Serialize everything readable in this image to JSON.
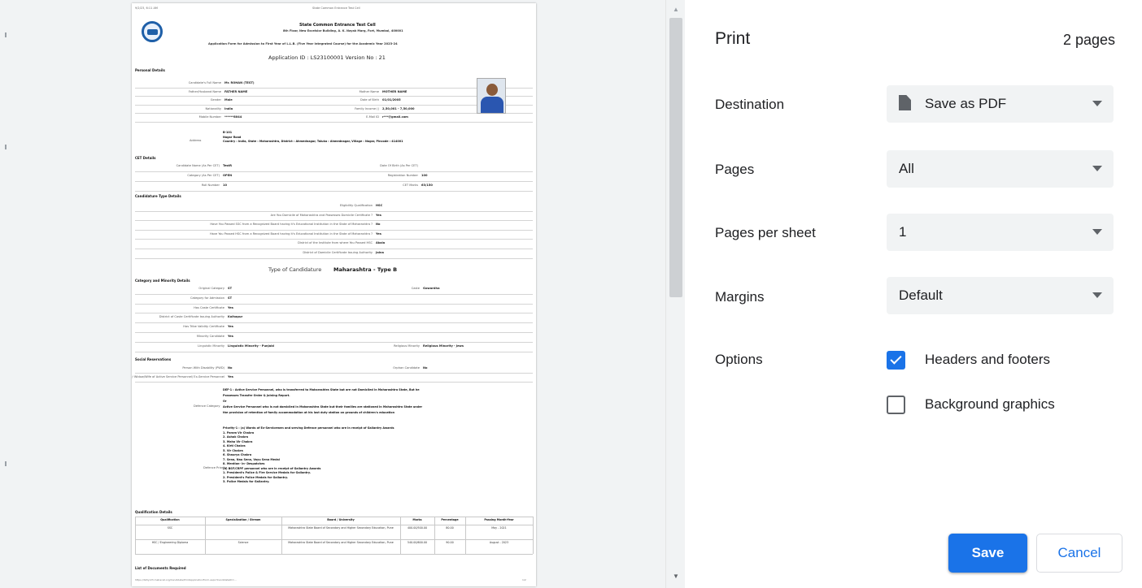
{
  "window": {
    "title": "Print"
  },
  "colors": {
    "accent": "#1a73e8",
    "panel_bg": "#ffffff",
    "preview_bg": "#f1f3f4"
  },
  "settings": {
    "title": "Print",
    "page_count": "2 pages",
    "destination": {
      "label": "Destination",
      "value": "Save as PDF",
      "icon": "pdf-file-icon"
    },
    "pages": {
      "label": "Pages",
      "value": "All"
    },
    "pages_per_sheet": {
      "label": "Pages per sheet",
      "value": "1"
    },
    "margins": {
      "label": "Margins",
      "value": "Default"
    },
    "options": {
      "label": "Options",
      "headers_footers": {
        "label": "Headers and footers",
        "checked": true
      },
      "background_graphics": {
        "label": "Background graphics",
        "checked": false
      }
    },
    "save_label": "Save",
    "cancel_label": "Cancel"
  },
  "preview": {
    "header_left": "9/2/23, 6:11 AM",
    "header_center": "State Common Entrance Test Cell",
    "org_name": "State Common Entrance Test Cell",
    "org_address": "8th Floor, New Excelsior Building, A. K. Nayak Marg, Fort, Mumbai, 400001",
    "form_title": "Application Form for Admission to First Year of L.L.B. (Five Year Integrated Course) for the Academic Year 2023-24",
    "application_line": "Application ID : LS23100001   Version No : 21",
    "sections": {
      "personal": "Personal Details",
      "cet": "CET Details",
      "candidature": "Candidature Type Details",
      "category": "Category and Minority Details",
      "social": "Social Reservations",
      "qualification": "Qualification Details",
      "documents": "List of Documents Required"
    },
    "personal": [
      {
        "label": "Candidate's Full Name",
        "value": "Mr. ROHAN (TEST)"
      },
      {
        "label": "Father/Husband Name",
        "value": "FATHER NAME",
        "label2": "Mother Name",
        "value2": "MOTHER NAME"
      },
      {
        "label": "Gender",
        "value": "Male",
        "label2": "Date of Birth",
        "value2": "01/01/2005"
      },
      {
        "label": "Nationality",
        "value": "India",
        "label2": "Family Income ()",
        "value2": "2,50,001 - 7,50,000"
      },
      {
        "label": "Mobile Number",
        "value": "******8044",
        "label2": "E-Mail ID",
        "value2": "r***@gmail.com"
      }
    ],
    "address_label": "Address",
    "address_lines": [
      "B-101",
      "Nagar Road",
      "Country : India, State : Maharashtra, District : Ahmednagar, Taluka : Ahmednagar, Village : Nagar, Pincode : 414001"
    ],
    "cet": [
      {
        "label": "Candidate Name (As Per CET)",
        "value": "TestR",
        "label2": "Date Of Birth (As Per CET)",
        "value2": ""
      },
      {
        "label": "Category (As Per CET)",
        "value": "OPEN",
        "label2": "Registration Number",
        "value2": "100"
      },
      {
        "label": "Roll Number",
        "value": "10",
        "label2": "CET Marks",
        "value2": "63/150"
      }
    ],
    "candidature": [
      {
        "label": "Eligibility Qualification",
        "value": "HSC"
      },
      {
        "label": "Are You Domicile of Maharashtra and Possesses Domicile Certificate ?",
        "value": "Yes"
      },
      {
        "label": "Have You Passed SSC from a Recognized Board having it's Educational Institution in the State of Maharashtra ?",
        "value": "No"
      },
      {
        "label": "Have You Passed HSC from a Recognized Board having it's Educational Institution in the State of Maharashtra ?",
        "value": "Yes"
      },
      {
        "label": "District of the Institute from where You Passed HSC",
        "value": "Akola"
      },
      {
        "label": "District of Domicile Certificate Issuing Authority",
        "value": "Jalna"
      }
    ],
    "candidature_type": {
      "label": "Type of Candidature",
      "value": "Maharashtra - Type B"
    },
    "category": [
      {
        "label": "Original Category",
        "value": "ST",
        "label2": "Caste",
        "value2": "Gowardha"
      },
      {
        "label": "Category for Admission",
        "value": "ST"
      },
      {
        "label": "Has Caste Certificate",
        "value": "Yes"
      },
      {
        "label": "District of Caste Certificate Issuing Authority",
        "value": "Kolhapur"
      },
      {
        "label": "Has Tribe Validity Certificate",
        "value": "Yes"
      },
      {
        "label": "Minority Candidate",
        "value": "Yes"
      },
      {
        "label": "Linguistic Minority",
        "value": "Linguistic Minority - Punjabi",
        "label2": "Religious Minority",
        "value2": "Religious Minority - Jews"
      }
    ],
    "social": [
      {
        "label": "Person With Disability (PWD)",
        "value": "No",
        "label2": "Orphan Candidate",
        "value2": "No"
      },
      {
        "label": "Are you the Son/ Daughter/ Widow/Wife of Active Service Personnel/ Ex-Service Personnel",
        "value": "Yes"
      }
    ],
    "defence_category_label": "Defence Category",
    "defence_category_lines": [
      "DEF-1 : Active Service Personnel, who is transferred to Maharashtra State but are not Domiciled in Maharashtra State, But he",
      "Possesses Transfer Order & Joining Report.",
      "Or",
      "Active Service Personnel who is not domiciled in Maharashtra State but their families are stationed in Maharashtra State under",
      "the provision of retention of family accommodation at his last duty station on grounds of children's education"
    ],
    "defence_priority_label": "Defence Priority",
    "defence_priority_lines": [
      "Priority-1 : (a) Wards of Ex-Servicemen and serving Defence personnel who are in receipt of Gallantry Awards",
      "1. Param Vir Chakra",
      "2. Ashok Chakra",
      "3. Maha Vir Chakra",
      "4. Kirti Chakra",
      "5. Vir Chakra",
      "6. Shaurya Chakra",
      "7. Sena, Nau Sena, Vayu Sena Medal",
      "8. Mention- in- Despatches",
      "(b) BSF/CRPF personnel who are in receipt of Gallantry Awards",
      "1. President's Police & Fire Service Medals for Gallantry.",
      "2. President's Police Medals for Gallantry.",
      "3. Police Medals for Gallantry."
    ],
    "qual_headers": [
      "Qualification",
      "Specialization / Stream",
      "Board / University",
      "Marks",
      "Percentage",
      "Passing Month-Year"
    ],
    "qual_rows": [
      [
        "SSC",
        "",
        "Maharashtra State Board of Secondary and Higher Secondary Education, Pune",
        "400.00/500.00",
        "80.00",
        "May - 2021"
      ],
      [
        "HSC / Engineering Diploma",
        "Science",
        "Maharashtra State Board of Secondary and Higher Secondary Education, Pune",
        "540.00/600.00",
        "90.00",
        "August - 2023"
      ]
    ],
    "footer_url": "https://lls5yr23.mahacet.org/Candidate/PrintApplicationForm.aspx?CandidateID=...",
    "footer_page": "1/2"
  }
}
